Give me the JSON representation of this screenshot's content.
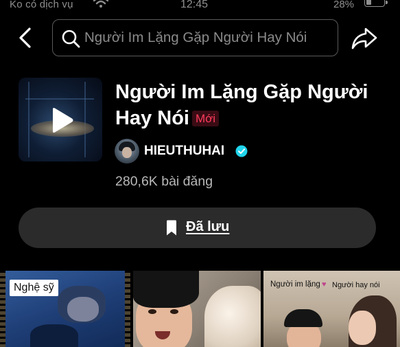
{
  "status_bar": {
    "carrier": "Ko có dịch vụ",
    "time": "12:45",
    "battery_percent": "28%",
    "battery_level": 0.28
  },
  "header": {
    "back_icon": "chevron-left-icon",
    "search": {
      "icon": "search-icon",
      "value": "Người Im Lặng Gặp Người Hay Nói",
      "placeholder": "Người Im Lặng Gặp Người Hay Nói"
    },
    "share_icon": "share-arrow-icon"
  },
  "sound": {
    "title": "Người Im Lặng Gặp Người Hay Nói",
    "badge": "Mới",
    "artist": "HIEUTHUHAI",
    "verified": true,
    "post_count": "280,6K bài đăng",
    "play_icon": "play-icon"
  },
  "saved_button": {
    "icon": "bookmark-icon",
    "label": "Đã lưu"
  },
  "videos": [
    {
      "tag": "Nghệ sỹ"
    },
    {},
    {
      "overlay_left": "Người im lặng",
      "overlay_heart": "♥",
      "overlay_right": "Người hay nói"
    }
  ],
  "colors": {
    "background": "#000000",
    "badge_red": "#ff3b5c",
    "verified_blue": "#20d5ec",
    "button_bg": "#2b2b2b"
  }
}
